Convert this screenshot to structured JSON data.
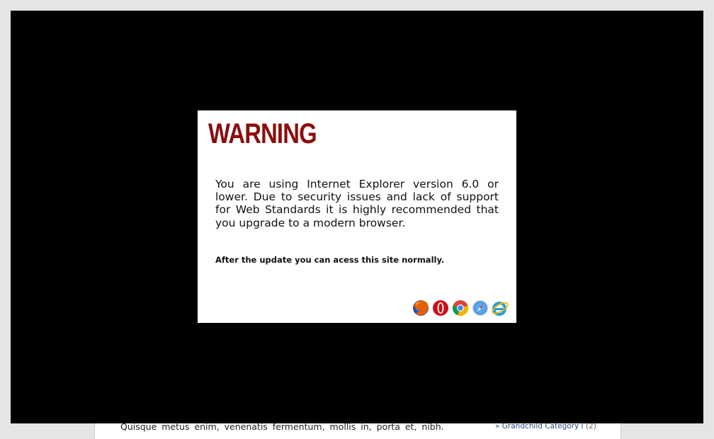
{
  "background_page": {
    "body_text": "Quisque metus enim, venenatis fermentum, mollis in, porta et, nibh.",
    "category_link": {
      "prefix": "»",
      "label": "Grandchild Category I",
      "count": "(2)"
    }
  },
  "dialog": {
    "title": "WARNING",
    "message": "You are using Internet Explorer version 6.0 or lower. Due to security issues and lack of support for Web Standards it is highly recommended that you upgrade to a modern browser.",
    "note": "After the update you can acess this site normally.",
    "browsers": [
      {
        "icon": "firefox-icon",
        "color": "#e66000"
      },
      {
        "icon": "opera-icon",
        "color": "#cc0f16"
      },
      {
        "icon": "chrome-icon",
        "color": "#4285f4"
      },
      {
        "icon": "safari-icon",
        "color": "#1e6fd9"
      },
      {
        "icon": "internet-explorer-icon",
        "color": "#1ea1e1"
      }
    ]
  },
  "colors": {
    "overlay": "#000000",
    "title": "#8b0d0d",
    "link": "#2a4d8a"
  }
}
